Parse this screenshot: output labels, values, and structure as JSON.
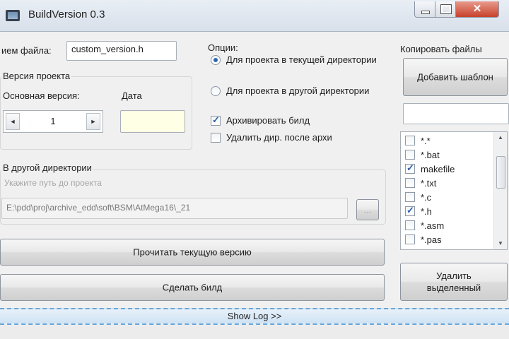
{
  "window": {
    "title": "BuildVersion 0.3"
  },
  "file": {
    "label": "ием файла:",
    "value": "custom_version.h"
  },
  "version": {
    "group_title": "Версия проекта",
    "main_label": "Основная версия:",
    "date_label": "Дата",
    "main_value": "1",
    "date_value": "",
    "down_arrow": "◄",
    "up_arrow": "►"
  },
  "options": {
    "title": "Опции:",
    "radio_current": "Для проекта в текущей директории",
    "radio_other": "Для проекта в другой директории",
    "check_archive": "Архивировать билд",
    "check_delete": "Удалить дир. после архи",
    "radio_current_selected": true,
    "check_archive_checked": true,
    "check_delete_checked": false
  },
  "other_dir": {
    "title": "В другой директории",
    "hint": "Укажите путь до проекта",
    "path": "E:\\pdd\\proj\\archive_edd\\soft\\BSM\\AtMega16\\_21",
    "browse": "..."
  },
  "copy": {
    "title": "Копировать файлы",
    "add_button": "Добавить шаблон",
    "pattern_value": "",
    "remove_button": "Удалить выделенный",
    "up_arrow": "▲",
    "down_arrow": "▼",
    "items": [
      {
        "label": "*.*",
        "checked": false
      },
      {
        "label": "*.bat",
        "checked": false
      },
      {
        "label": "makefile",
        "checked": true
      },
      {
        "label": "*.txt",
        "checked": false
      },
      {
        "label": "*.c",
        "checked": false
      },
      {
        "label": "*.h",
        "checked": true
      },
      {
        "label": "*.asm",
        "checked": false
      },
      {
        "label": "*.pas",
        "checked": false
      }
    ]
  },
  "actions": {
    "read_version": "Прочитать текущую версию",
    "make_build": "Сделать билд",
    "show_log": "Show Log >>"
  },
  "colors": {
    "accent": "#2a67b5",
    "date_bg": "#ffffe6",
    "log_bar": "#cfe2f3"
  }
}
